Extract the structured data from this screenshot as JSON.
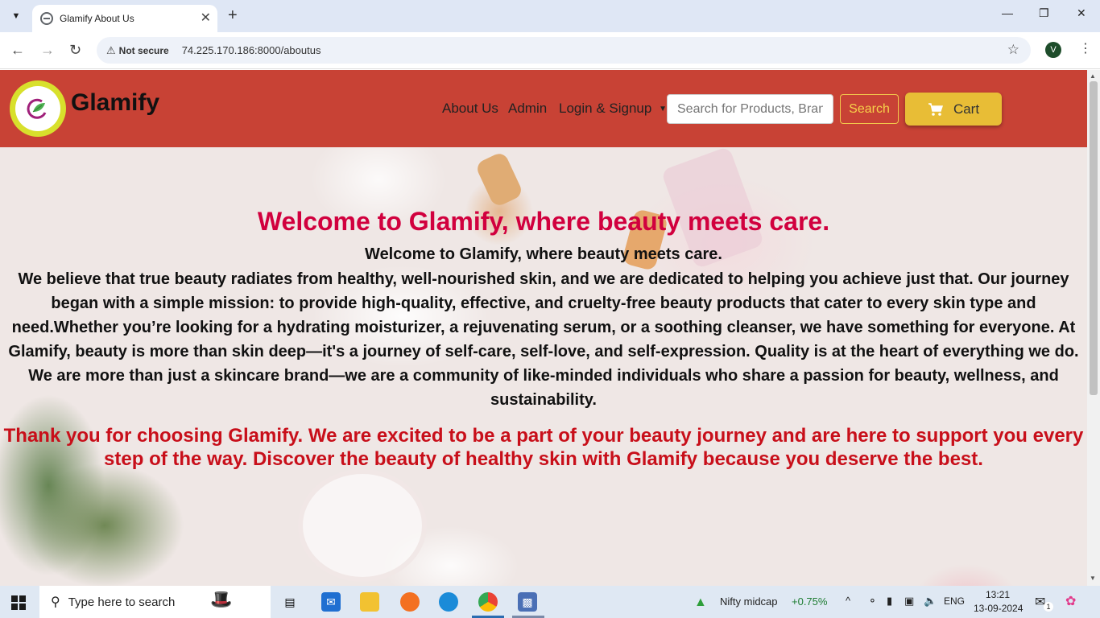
{
  "browser": {
    "tab_title": "Glamify About Us",
    "security_label": "Not secure",
    "url": "74.225.170.186:8000/aboutus",
    "profile_initial": "V"
  },
  "site": {
    "brand": "Glamify",
    "nav": {
      "about": "About Us",
      "admin": "Admin",
      "login": "Login & Signup"
    },
    "search": {
      "placeholder": "Search for Products, Brands",
      "button": "Search"
    },
    "cart": "Cart",
    "colors": {
      "header": "#c84235",
      "logo_ring": "#d8e02c",
      "cart": "#e8bd36",
      "heading": "#d1003e",
      "thanks": "#c80f1a"
    }
  },
  "about": {
    "heading": "Welcome to Glamify, where beauty meets care.",
    "subheading": "Welcome to Glamify, where beauty meets care.",
    "body": "We believe that true beauty radiates from healthy, well-nourished skin, and we are dedicated to helping you achieve just that. Our journey began with a simple mission: to provide high-quality, effective, and cruelty-free beauty products that cater to every skin type and need.Whether you’re looking for a hydrating moisturizer, a rejuvenating serum, or a soothing cleanser, we have something for everyone. At Glamify, beauty is more than skin deep—it's a journey of self-care, self-love, and self-expression. Quality is at the heart of everything we do. We are more than just a skincare brand—we are a community of like-minded individuals who share a passion for beauty, wellness, and sustainability.",
    "thanks": "Thank you for choosing Glamify. We are excited to be a part of your beauty journey and are here to support you every step of the way. Discover the beauty of healthy skin with Glamify because you deserve the best."
  },
  "taskbar": {
    "search_placeholder": "Type here to search",
    "ticker_name": "Nifty midcap",
    "ticker_change": "+0.75%",
    "language": "ENG",
    "time": "13:21",
    "date": "13-09-2024",
    "notification_count": "1"
  }
}
